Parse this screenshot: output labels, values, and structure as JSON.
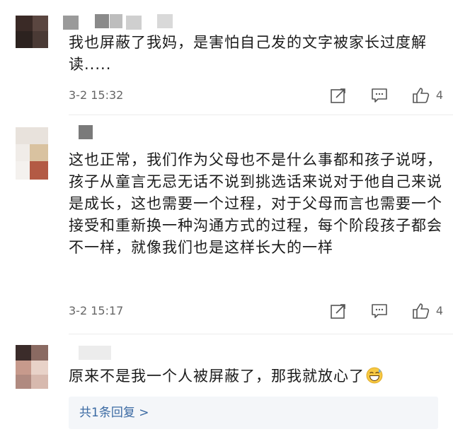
{
  "comments": [
    {
      "text": "我也屏蔽了我妈，是害怕自己发的文字被家长过度解读.....",
      "time": "3-2 15:32",
      "likes": "4",
      "icons": [
        "repost-icon",
        "comment-icon",
        "like-icon"
      ]
    },
    {
      "text": "这也正常，我们作为父母也不是什么事都和孩子说呀，孩子从童言无忌无话不说到挑选话来说对于他自己来说是成长，这也需要一个过程，对于父母而言也需要一个接受和重新换一种沟通方式的过程，每个阶段孩子都会不一样，就像我们也是这样长大的一样",
      "time": "3-2 15:17",
      "likes": "4",
      "icons": [
        "repost-icon",
        "comment-icon",
        "like-icon"
      ]
    },
    {
      "text": "原来不是我一个人被屏蔽了，那我就放心了",
      "emoji": "grinning-sweat-emoji",
      "reply_link": "共1条回复 >"
    }
  ],
  "colors": {
    "link": "#3b6aa3",
    "meta": "#666666",
    "reply_bg": "#f4f6f9"
  }
}
